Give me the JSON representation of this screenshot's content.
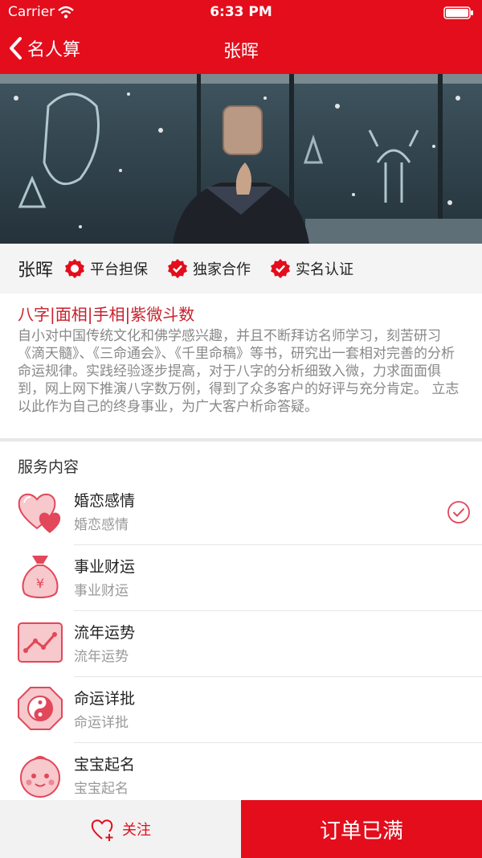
{
  "status": {
    "carrier": "Carrier",
    "time": "6:33 PM"
  },
  "nav": {
    "back_label": "名人算",
    "title": "张晖"
  },
  "profile": {
    "name": "张晖",
    "badges": [
      "平台担保",
      "独家合作",
      "实名认证"
    ],
    "tags": "八字|面相|手相|紫微斗数",
    "bio": "自小对中国传统文化和佛学感兴趣，并且不断拜访名师学习，刻苦研习《滴天髓》、《三命通会》、《千里命稿》等书，研究出一套相对完善的分析命运规律。实践经验逐步提高，对于八字的分析细致入微，力求面面俱到，网上网下推演八字数万例，得到了众多客户的好评与充分肯定。 立志以此作为自己的终身事业，为广大客户析命答疑。"
  },
  "services": {
    "title": "服务内容",
    "items": [
      {
        "name": "婚恋感情",
        "sub": "婚恋感情",
        "icon": "hearts-icon",
        "selected": true
      },
      {
        "name": "事业财运",
        "sub": "事业财运",
        "icon": "money-bag-icon",
        "selected": false
      },
      {
        "name": "流年运势",
        "sub": "流年运势",
        "icon": "trend-chart-icon",
        "selected": false
      },
      {
        "name": "命运详批",
        "sub": "命运详批",
        "icon": "yin-yang-icon",
        "selected": false
      },
      {
        "name": "宝宝起名",
        "sub": "宝宝起名",
        "icon": "baby-face-icon",
        "selected": false
      }
    ]
  },
  "bottom": {
    "follow_label": "关注",
    "order_label": "订单已满"
  },
  "colors": {
    "accent": "#e30d1c",
    "tag": "#c8202c"
  }
}
